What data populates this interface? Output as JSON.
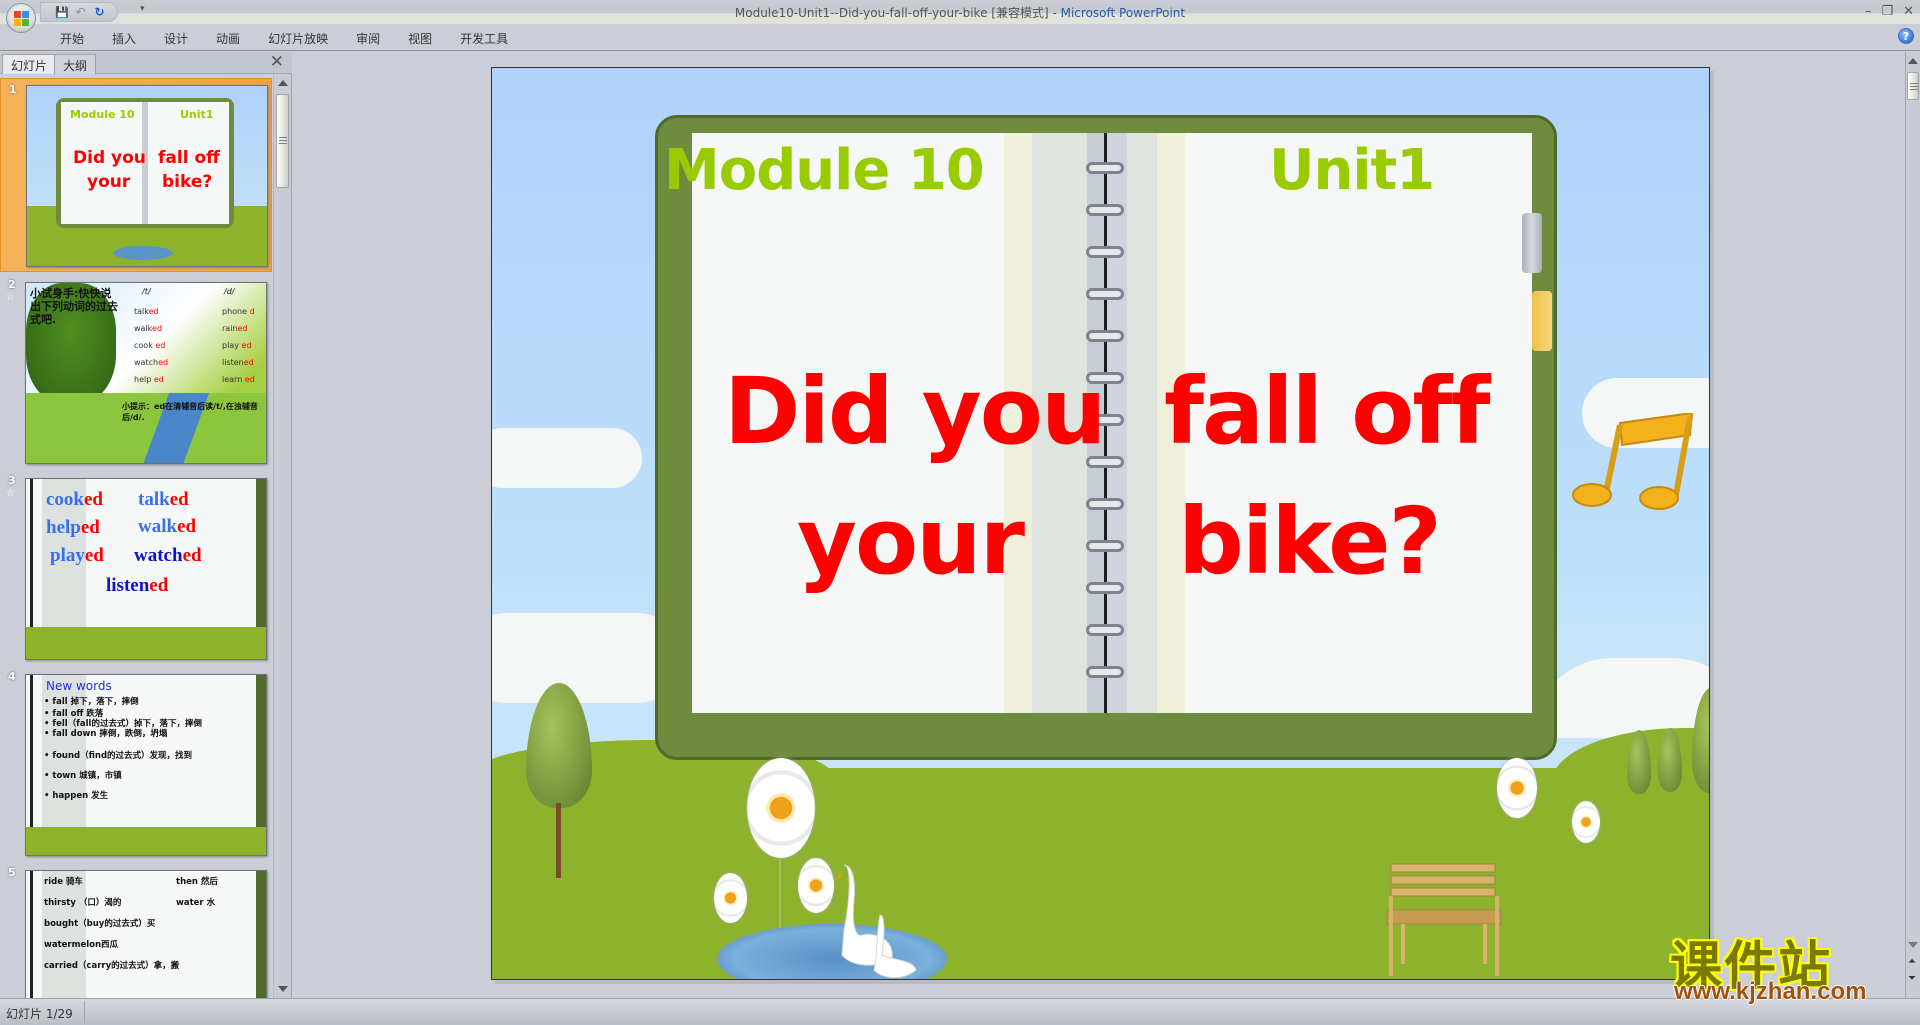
{
  "window": {
    "title": "Module10-Unit1--Did-you-fall-off-your-bike [兼容模式]",
    "title_separator": " - ",
    "app_name": "Microsoft PowerPoint",
    "controls": {
      "minimize": "–",
      "restore": "❐",
      "close": "✕"
    }
  },
  "quick_access": {
    "save_icon": "💾",
    "undo_icon": "↶",
    "redo_icon": "↻",
    "customize_icon": "▾"
  },
  "ribbon": {
    "tabs": [
      "开始",
      "插入",
      "设计",
      "动画",
      "幻灯片放映",
      "审阅",
      "视图",
      "开发工具"
    ],
    "help_icon": "?"
  },
  "left_panel": {
    "tabs": [
      "幻灯片",
      "大纲"
    ],
    "active_tab": "幻灯片",
    "close_icon": "✕",
    "thumbnails": [
      {
        "number": "1",
        "selected": true,
        "module": "Module 10",
        "unit": "Unit1",
        "title_left": [
          "Did you",
          "your"
        ],
        "title_right": [
          "fall off",
          "bike?"
        ]
      },
      {
        "number": "2",
        "has_animation": true,
        "heading": "小试身手:快快说出下列动词的过去式吧.",
        "col_t_header": "/t/",
        "col_d_header": "/d/",
        "col_t": [
          [
            "talk",
            "ed"
          ],
          [
            "walk",
            "ed"
          ],
          [
            "cook ",
            "ed"
          ],
          [
            "watch",
            "ed"
          ],
          [
            "help ",
            "ed"
          ]
        ],
        "col_d": [
          [
            "phone ",
            "d"
          ],
          [
            "rain",
            "ed"
          ],
          [
            "play ",
            "ed"
          ],
          [
            "listen",
            "ed"
          ],
          [
            "learn ",
            "ed"
          ]
        ],
        "tip": "小提示：ed在清辅音后读/t/,在浊辅音后/d/."
      },
      {
        "number": "3",
        "has_animation": true,
        "words": [
          [
            "cook",
            "ed"
          ],
          [
            "talk",
            "ed"
          ],
          [
            "help",
            "ed"
          ],
          [
            "walk",
            "ed"
          ],
          [
            "play",
            "ed"
          ],
          [
            "watch",
            "ed"
          ],
          [
            "listen",
            "ed"
          ]
        ]
      },
      {
        "number": "4",
        "heading": "New words",
        "lines": [
          "fall 掉下，落下，摔倒",
          "fall off 跌落",
          "fell（fall的过去式）掉下，落下，摔倒",
          "fall down 摔倒，跌倒，坍塌",
          "found（find的过去式）发现，找到",
          "town 城镇，市镇",
          "happen 发生"
        ]
      },
      {
        "number": "5",
        "left_words": [
          "ride 骑车",
          "thirsty （口）渴的",
          "bought（buy的过去式）买",
          "watermelon西瓜",
          "carried（carry的过去式）拿，搬"
        ],
        "right_words": [
          "then 然后",
          "water 水"
        ]
      }
    ]
  },
  "slide": {
    "module": "Module 10",
    "unit": "Unit1",
    "title_left_line1": "Did you",
    "title_left_line2": "your",
    "title_right_line1": "fall off",
    "title_right_line2": "bike?",
    "colors": {
      "heading_green": "#99cc00",
      "title_red": "#ff0000",
      "sky": "#b0d2fb",
      "grass": "#8db22c",
      "book_cover": "#6f8c3e"
    }
  },
  "status_bar": {
    "slide_indicator": "幻灯片 1/29"
  },
  "watermark": {
    "text": "课件站",
    "url": "www.kjzhan.com"
  }
}
